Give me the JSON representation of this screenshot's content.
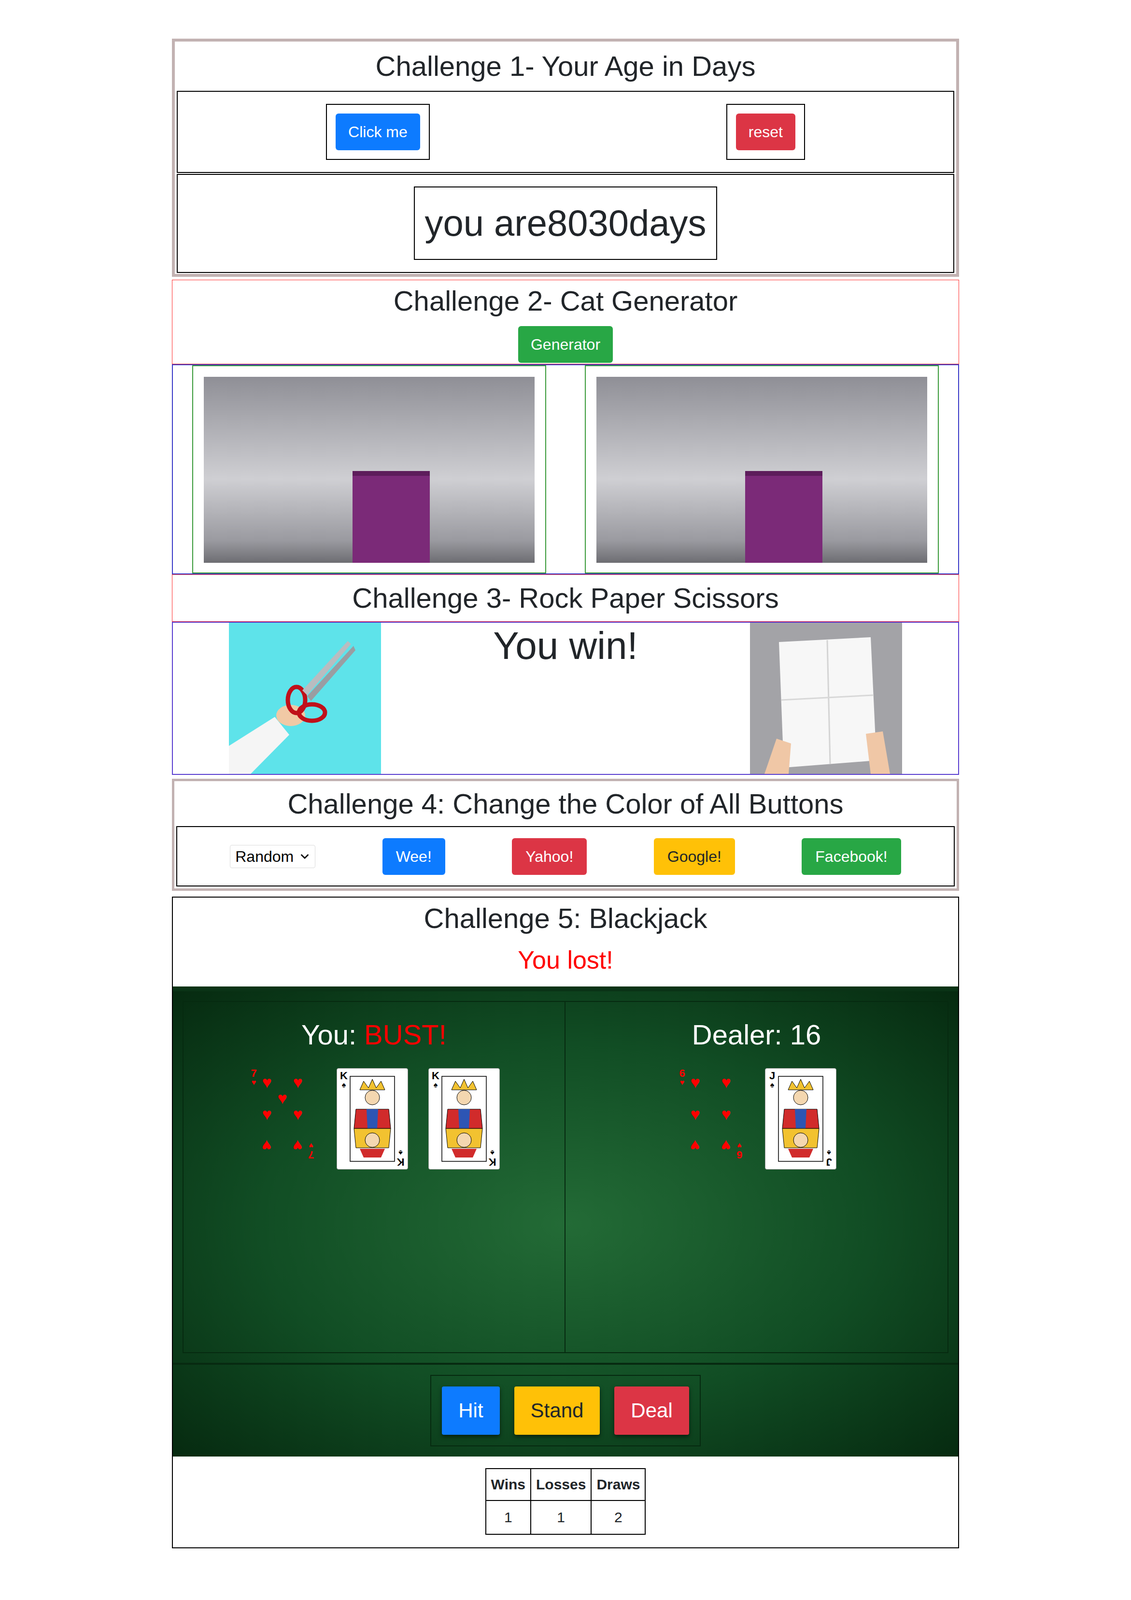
{
  "challenge1": {
    "title": "Challenge 1- Your Age in Days",
    "buttons": [
      {
        "label": "Click me",
        "color": "#0d7bff"
      },
      {
        "label": "reset",
        "color": "#dc3545"
      }
    ],
    "result": "you are8030days"
  },
  "challenge2": {
    "title": "Challenge 2- Cat Generator",
    "button": "Generator",
    "images": [
      {
        "kind": "photo"
      },
      {
        "kind": "photo"
      }
    ]
  },
  "challenge3": {
    "title": "Challenge 3- Rock Paper Scissors",
    "human": {
      "kind": "scissors"
    },
    "message": "You win!",
    "bot": {
      "kind": "paper"
    }
  },
  "challenge4": {
    "title": "Challenge 4: Change the Color of All Buttons",
    "select": {
      "value": "Random"
    },
    "buttons": [
      {
        "label": "Wee!",
        "color": "#0d7bff"
      },
      {
        "label": "Yahoo!",
        "color": "#dc3545"
      },
      {
        "label": "Google!",
        "color": "#ffc107"
      },
      {
        "label": "Facebook!",
        "color": "#28a745"
      }
    ]
  },
  "challenge5": {
    "title": "Challenge 5: Blackjack",
    "result": {
      "text": "You lost!",
      "outcome": "lost"
    },
    "player": {
      "label": "You:",
      "score": "BUST!",
      "bust": true,
      "cards": [
        {
          "rank": "7",
          "suit": "♥",
          "color": "#ff0000",
          "kind": "pips"
        },
        {
          "rank": "K",
          "suit": "♠",
          "color": "#000000",
          "kind": "face"
        },
        {
          "rank": "K",
          "suit": "♠",
          "color": "#000000",
          "kind": "face"
        }
      ]
    },
    "dealer": {
      "label": "Dealer:",
      "score": "16",
      "bust": false,
      "cards": [
        {
          "rank": "6",
          "suit": "♥",
          "color": "#ff0000",
          "kind": "pips"
        },
        {
          "rank": "J",
          "suit": "♠",
          "color": "#000000",
          "kind": "face"
        }
      ]
    },
    "buttons": [
      {
        "label": "Hit",
        "color": "#0d7bff"
      },
      {
        "label": "Stand",
        "color": "#ffc107"
      },
      {
        "label": "Deal",
        "color": "#dc3545"
      }
    ],
    "stats": {
      "columns": [
        "Wins",
        "Losses",
        "Draws"
      ],
      "rows": [
        [
          "1",
          "1",
          "2"
        ]
      ]
    }
  }
}
